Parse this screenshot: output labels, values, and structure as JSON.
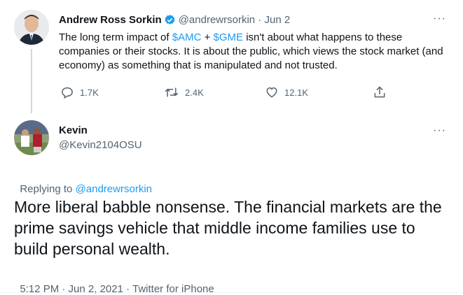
{
  "original_tweet": {
    "author_name": "Andrew Ross Sorkin",
    "handle": "@andrewrsorkin",
    "date_sep": " · ",
    "date": "Jun 2",
    "more": "···",
    "text_part1": "The long term impact of ",
    "tag1": "$AMC",
    "text_plus": " + ",
    "tag2": "$GME",
    "text_part2": " isn't about what happens to these companies or their stocks. It is about the public, which views the stock market (and economy) as something that is manipulated and not trusted.",
    "replies": "1.7K",
    "retweets": "2.4K",
    "likes": "12.1K",
    "colors": {
      "verified": "#1d9bf0",
      "link": "#1d9bf0"
    }
  },
  "reply_tweet": {
    "author_name": "Kevin",
    "handle": "@Kevin2104OSU",
    "more": "···",
    "replying_prefix": "Replying to ",
    "replying_handle": "@andrewrsorkin",
    "text": "More liberal babble nonsense. The financial markets are the prime savings vehicle that middle income families use to build personal wealth.",
    "timestamp": "5:12 PM · Jun 2, 2021",
    "source_sep": " · ",
    "source": "Twitter for iPhone"
  }
}
